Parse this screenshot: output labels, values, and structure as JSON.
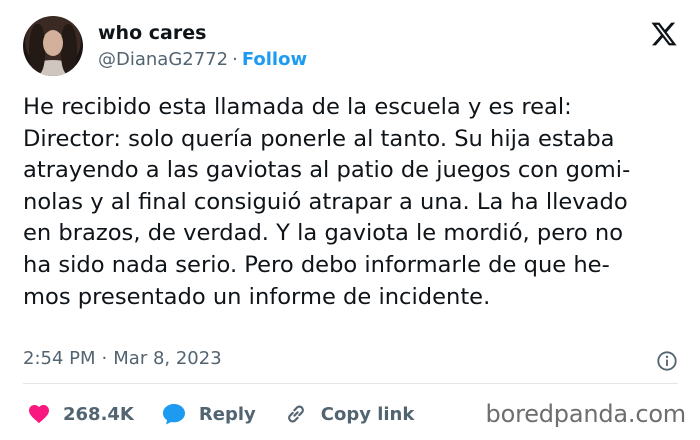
{
  "author": {
    "display_name": "who cares",
    "handle": "@DianaG2772",
    "separator": "·",
    "follow_label": "Follow"
  },
  "tweet": {
    "lines": [
      "He recibido esta llamada de la escuela y es real:",
      "Director: solo quería ponerle al tanto. Su hija estaba",
      "atrayendo a las gaviotas al patio de juegos con gomi-",
      "nolas y al final consiguió atrapar a una. La ha llevado",
      "en brazos, de verdad. Y la gaviota le mordió, pero no",
      "ha sido nada serio. Pero debo informarle de que he-",
      "mos presentado un informe de incidente."
    ],
    "time": "2:54 PM",
    "date": "Mar 8, 2023",
    "separator": "·"
  },
  "actions": {
    "likes_count": "268.4K",
    "reply_label": "Reply",
    "copy_link_label": "Copy link"
  },
  "icons": {
    "avatar": "profile-photo",
    "platform": "x-logo-icon",
    "info": "info-icon",
    "like": "heart-icon",
    "reply": "speech-bubble-icon",
    "copy_link": "link-icon"
  },
  "colors": {
    "text": "#0f1419",
    "secondary": "#536471",
    "accent": "#1d9bf0",
    "like": "#f91880",
    "divider": "#e1e6ea"
  },
  "watermark": "boredpanda.com"
}
